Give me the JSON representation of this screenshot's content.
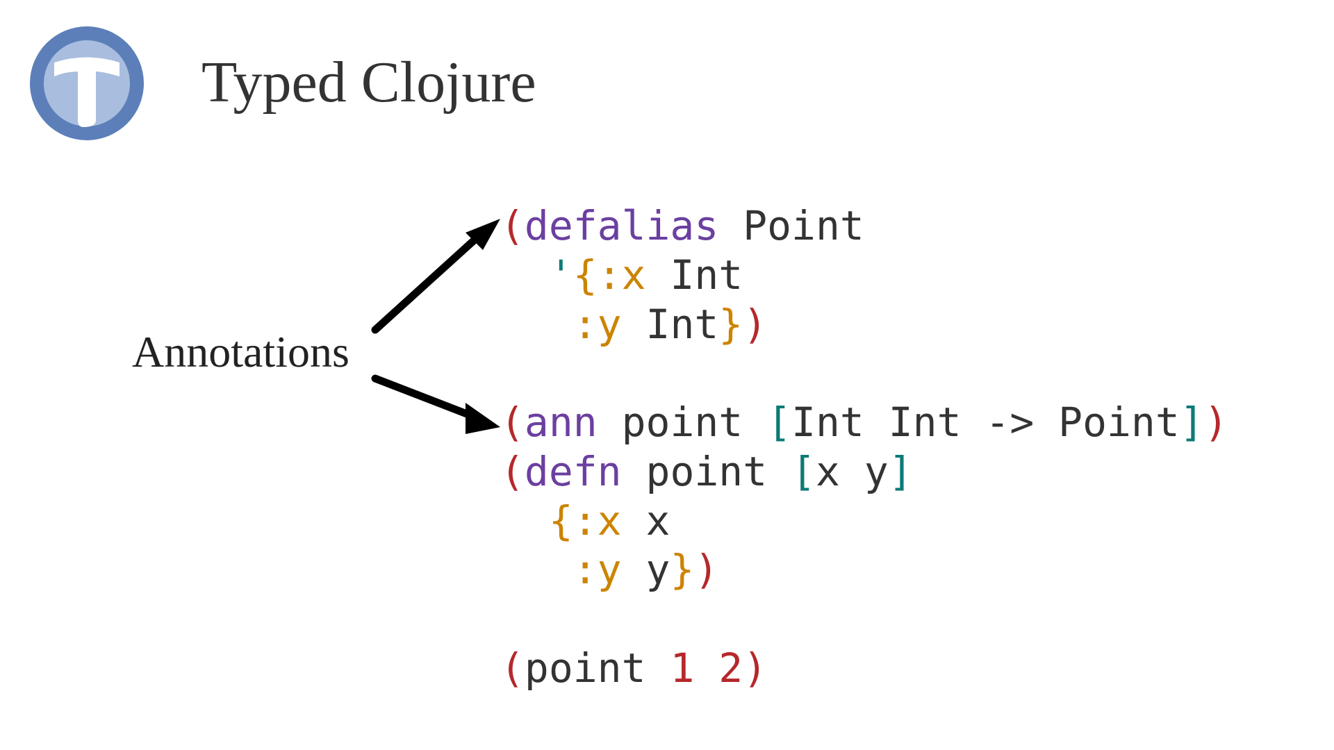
{
  "title": "Typed Clojure",
  "logo": {
    "glyph": "T",
    "ring_color": "#5d7fb9",
    "fill_color": "#a9bddf",
    "glyph_color": "#ffffff"
  },
  "annotations_label": "Annotations",
  "code": {
    "block1": {
      "line1": {
        "paren_open": "(",
        "kw": "defalias",
        "sp": " ",
        "name": "Point"
      },
      "line2": {
        "indent": "  ",
        "quote": "'",
        "brace_open": "{",
        "key": ":x",
        "sp": " ",
        "type": "Int"
      },
      "line3": {
        "indent": "   ",
        "key": ":y",
        "sp": " ",
        "type": "Int",
        "brace_close": "}",
        "paren_close": ")"
      }
    },
    "block2": {
      "line1": {
        "paren_open": "(",
        "kw": "ann",
        "sp": " ",
        "name": "point",
        "sp2": " ",
        "bracket_open": "[",
        "args": "Int Int -> Point",
        "bracket_close": "]",
        "paren_close": ")"
      },
      "line2": {
        "paren_open": "(",
        "kw": "defn",
        "sp": " ",
        "name": "point",
        "sp2": " ",
        "bracket_open": "[",
        "args": "x y",
        "bracket_close": "]"
      },
      "line3": {
        "indent": "  ",
        "brace_open": "{",
        "key": ":x",
        "sp": " ",
        "val": "x"
      },
      "line4": {
        "indent": "   ",
        "key": ":y",
        "sp": " ",
        "val": "y",
        "brace_close": "}",
        "paren_close": ")"
      }
    },
    "block3": {
      "line1": {
        "paren_open": "(",
        "fn": "point",
        "sp": " ",
        "n1": "1",
        "sp2": " ",
        "n2": "2",
        "paren_close": ")"
      }
    }
  }
}
